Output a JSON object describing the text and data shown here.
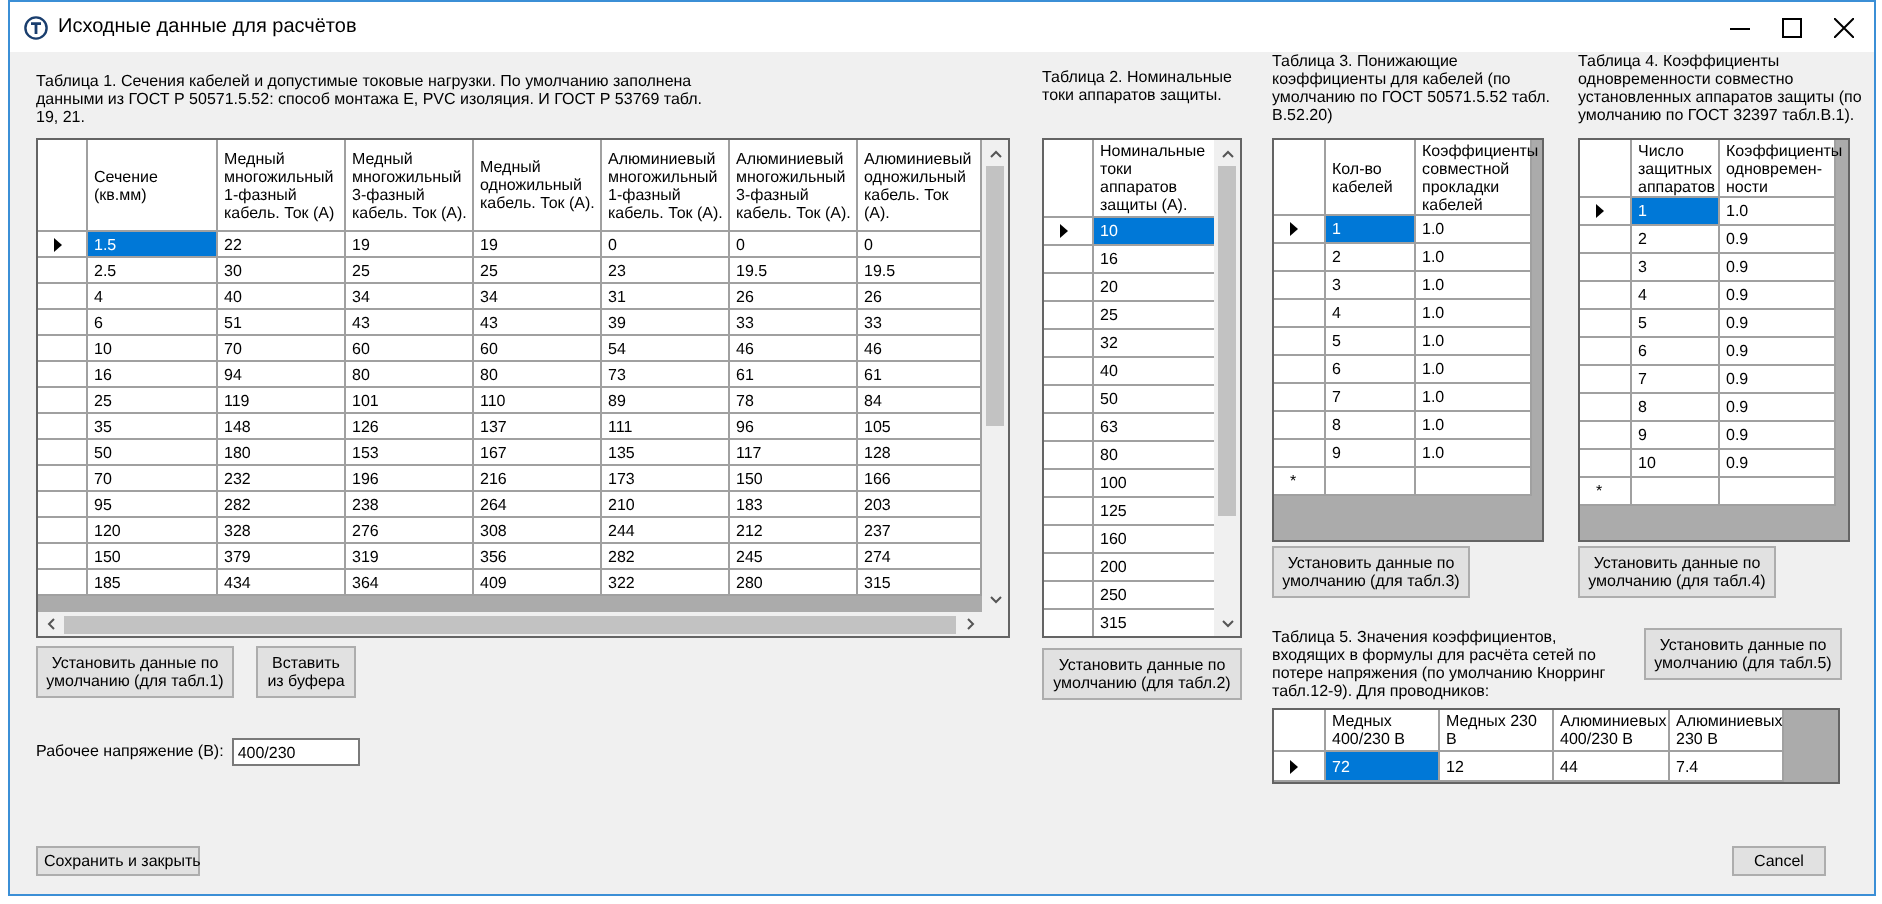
{
  "window": {
    "title": "Исходные данные для расчётов"
  },
  "table1": {
    "caption": "Таблица 1. Сечения кабелей и допустимые токовые нагрузки. По умолчанию заполнена данными из ГОСТ Р 50571.5.52: способ монтажа Е, PVC изоляция. И ГОСТ Р 53769 табл. 19, 21.",
    "columns": [
      "Сечение (кв.мм)",
      "Медный многожильный 1-фазный кабель. Ток (А)",
      "Медный многожильный 3-фазный кабель. Ток (А).",
      "Медный одножильный кабель. Ток (А).",
      "Алюминиевый многожильный 1-фазный кабель. Ток (А).",
      "Алюминиевый многожильный 3-фазный кабель. Ток (А).",
      "Алюминиевый одножильный кабель. Ток (А)."
    ],
    "rows": [
      {
        "cells": [
          "1.5",
          "22",
          "19",
          "19",
          "0",
          "0",
          "0"
        ],
        "selected": true
      },
      {
        "cells": [
          "2.5",
          "30",
          "25",
          "25",
          "23",
          "19.5",
          "19.5"
        ],
        "selected": false
      },
      {
        "cells": [
          "4",
          "40",
          "34",
          "34",
          "31",
          "26",
          "26"
        ],
        "selected": false
      },
      {
        "cells": [
          "6",
          "51",
          "43",
          "43",
          "39",
          "33",
          "33"
        ],
        "selected": false
      },
      {
        "cells": [
          "10",
          "70",
          "60",
          "60",
          "54",
          "46",
          "46"
        ],
        "selected": false
      },
      {
        "cells": [
          "16",
          "94",
          "80",
          "80",
          "73",
          "61",
          "61"
        ],
        "selected": false
      },
      {
        "cells": [
          "25",
          "119",
          "101",
          "110",
          "89",
          "78",
          "84"
        ],
        "selected": false
      },
      {
        "cells": [
          "35",
          "148",
          "126",
          "137",
          "111",
          "96",
          "105"
        ],
        "selected": false
      },
      {
        "cells": [
          "50",
          "180",
          "153",
          "167",
          "135",
          "117",
          "128"
        ],
        "selected": false
      },
      {
        "cells": [
          "70",
          "232",
          "196",
          "216",
          "173",
          "150",
          "166"
        ],
        "selected": false
      },
      {
        "cells": [
          "95",
          "282",
          "238",
          "264",
          "210",
          "183",
          "203"
        ],
        "selected": false
      },
      {
        "cells": [
          "120",
          "328",
          "276",
          "308",
          "244",
          "212",
          "237"
        ],
        "selected": false
      },
      {
        "cells": [
          "150",
          "379",
          "319",
          "356",
          "282",
          "245",
          "274"
        ],
        "selected": false
      },
      {
        "cells": [
          "185",
          "434",
          "364",
          "409",
          "322",
          "280",
          "315"
        ],
        "selected": false
      }
    ]
  },
  "table1_buttons": [
    "Установить данные по умолчанию (для табл.1)",
    "Вставить из буфера"
  ],
  "voltage": {
    "label": "Рабочее напряжение (В):",
    "value": "400/230"
  },
  "table2": {
    "caption": "Таблица 2. Номинальные токи аппаратов защиты.",
    "columns": [
      "Номинальные токи аппаратов защиты (А)."
    ],
    "rows": [
      {
        "cells": [
          "10"
        ],
        "selected": true
      },
      {
        "cells": [
          "16"
        ],
        "selected": false
      },
      {
        "cells": [
          "20"
        ],
        "selected": false
      },
      {
        "cells": [
          "25"
        ],
        "selected": false
      },
      {
        "cells": [
          "32"
        ],
        "selected": false
      },
      {
        "cells": [
          "40"
        ],
        "selected": false
      },
      {
        "cells": [
          "50"
        ],
        "selected": false
      },
      {
        "cells": [
          "63"
        ],
        "selected": false
      },
      {
        "cells": [
          "80"
        ],
        "selected": false
      },
      {
        "cells": [
          "100"
        ],
        "selected": false
      },
      {
        "cells": [
          "125"
        ],
        "selected": false
      },
      {
        "cells": [
          "160"
        ],
        "selected": false
      },
      {
        "cells": [
          "200"
        ],
        "selected": false
      },
      {
        "cells": [
          "250"
        ],
        "selected": false
      },
      {
        "cells": [
          "315"
        ],
        "selected": false
      }
    ],
    "button": "Установить данные по умолчанию (для табл.2)"
  },
  "table3": {
    "caption": "Таблица 3. Понижающие коэффициенты для кабелей (по умолчанию по ГОСТ 50571.5.52 табл. В.52.20)",
    "columns": [
      "Кол-во кабелей",
      "Коэффициенты совместной прокладки кабелей"
    ],
    "rows": [
      {
        "cells": [
          "1",
          "1.0"
        ],
        "selected": true
      },
      {
        "cells": [
          "2",
          "1.0"
        ],
        "selected": false
      },
      {
        "cells": [
          "3",
          "1.0"
        ],
        "selected": false
      },
      {
        "cells": [
          "4",
          "1.0"
        ],
        "selected": false
      },
      {
        "cells": [
          "5",
          "1.0"
        ],
        "selected": false
      },
      {
        "cells": [
          "6",
          "1.0"
        ],
        "selected": false
      },
      {
        "cells": [
          "7",
          "1.0"
        ],
        "selected": false
      },
      {
        "cells": [
          "8",
          "1.0"
        ],
        "selected": false
      },
      {
        "cells": [
          "9",
          "1.0"
        ],
        "selected": false
      }
    ],
    "new_row_marker": "*",
    "button": "Установить данные по умолчанию (для табл.3)"
  },
  "table4": {
    "caption": "Таблица 4. Коэффициенты одновременности совместно установленных аппаратов защиты (по умолчанию по ГОСТ 32397 табл.В.1).",
    "columns": [
      "Число защитных аппаратов",
      "Коэффициенты одновремен-ности"
    ],
    "rows": [
      {
        "cells": [
          "1",
          "1.0"
        ],
        "selected": true
      },
      {
        "cells": [
          "2",
          "0.9"
        ],
        "selected": false
      },
      {
        "cells": [
          "3",
          "0.9"
        ],
        "selected": false
      },
      {
        "cells": [
          "4",
          "0.9"
        ],
        "selected": false
      },
      {
        "cells": [
          "5",
          "0.9"
        ],
        "selected": false
      },
      {
        "cells": [
          "6",
          "0.9"
        ],
        "selected": false
      },
      {
        "cells": [
          "7",
          "0.9"
        ],
        "selected": false
      },
      {
        "cells": [
          "8",
          "0.9"
        ],
        "selected": false
      },
      {
        "cells": [
          "9",
          "0.9"
        ],
        "selected": false
      },
      {
        "cells": [
          "10",
          "0.9"
        ],
        "selected": false
      }
    ],
    "new_row_marker": "*",
    "button": "Установить данные по умолчанию (для табл.4)"
  },
  "table5": {
    "caption": "Таблица 5. Значения коэффициентов, входящих в формулы для расчёта сетей по потере напряжения (по умолчанию Кнорринг табл.12-9). Для проводников:",
    "columns": [
      "Медных 400/230 В",
      "Медных 230 В",
      "Алюминиевых 400/230 В",
      "Алюминиевых 230 В"
    ],
    "rows": [
      {
        "cells": [
          "72",
          "12",
          "44",
          "7.4"
        ],
        "selected": true
      }
    ],
    "button": "Установить данные по умолчанию (для табл.5)"
  },
  "save_button": "Сохранить и закрыть",
  "cancel_button": "Cancel"
}
